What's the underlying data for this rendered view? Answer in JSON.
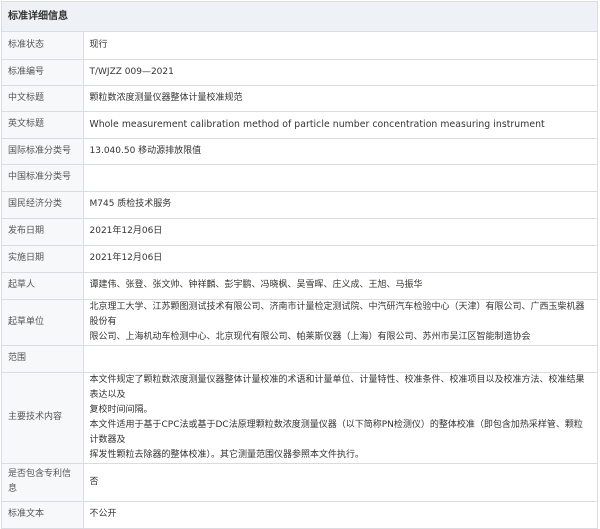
{
  "panel": {
    "title": "标准详细信息"
  },
  "rows": [
    {
      "key": "status",
      "label": "标准状态",
      "value": "现行"
    },
    {
      "key": "number",
      "label": "标准编号",
      "value": "T/WJZZ 009—2021"
    },
    {
      "key": "cn_title",
      "label": "中文标题",
      "value": "颗粒数浓度测量仪器整体计量校准规范"
    },
    {
      "key": "en_title",
      "label": "英文标题",
      "value": "Whole measurement calibration method of particle number concentration measuring instrument"
    },
    {
      "key": "ics",
      "label": "国际标准分类号",
      "value": "13.040.50 移动源排放限值"
    },
    {
      "key": "ccs",
      "label": "中国标准分类号",
      "value": ""
    },
    {
      "key": "economy",
      "label": "国民经济分类",
      "value": "M745 质检技术服务"
    },
    {
      "key": "publish_date",
      "label": "发布日期",
      "value": "2021年12月06日"
    },
    {
      "key": "implement_date",
      "label": "实施日期",
      "value": "2021年12月06日"
    },
    {
      "key": "drafters",
      "label": "起草人",
      "value": "谭建伟、张登、张文帅、钟祥麟、彭宇鹏、冯晓枫、吴雪晖、庄义成、王旭、马振华"
    },
    {
      "key": "units",
      "label": "起草单位",
      "lines": [
        "北京理工大学、江苏颗图测试技术有限公司、济南市计量检定测试院、中汽研汽车检验中心（天津）有限公司、广西玉柴机器股份有",
        "限公司、上海机动车检测中心、北京现代有限公司、帕莱斯仪器（上海）有限公司、苏州市吴江区智能制造协会"
      ]
    },
    {
      "key": "scope",
      "label": "范围",
      "value": ""
    },
    {
      "key": "tech",
      "label": "主要技术内容",
      "lines": [
        "本文件规定了颗粒数浓度测量仪器整体计量校准的术语和计量单位、计量特性、校准条件、校准项目以及校准方法、校准结果表达以及",
        "复校时间间隔。",
        "本文件适用于基于CPC法或基于DC法原理颗粒数浓度测量仪器（以下简称PN检测仪）的整体校准（即包含加热采样管、颗粒计数器及",
        "挥发性颗粒去除器的整体校准）。其它测量范围仪器参照本文件执行。"
      ]
    },
    {
      "key": "patent",
      "label": "是否包含专利信息",
      "value": "否"
    },
    {
      "key": "text",
      "label": "标准文本",
      "value": "不公开"
    }
  ]
}
